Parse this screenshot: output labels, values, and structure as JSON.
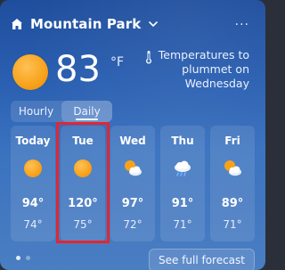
{
  "header": {
    "location": "Mountain Park",
    "more_label": "···"
  },
  "current": {
    "temperature": "83",
    "unit": "°F"
  },
  "alert": {
    "text": "Temperatures to plummet on Wednesday"
  },
  "toggle": {
    "hourly": "Hourly",
    "daily": "Daily",
    "active": "Daily"
  },
  "forecast": [
    {
      "day": "Today",
      "icon": "sun-icon",
      "hi": "94°",
      "lo": "74°"
    },
    {
      "day": "Tue",
      "icon": "sun-icon",
      "hi": "120°",
      "lo": "75°"
    },
    {
      "day": "Wed",
      "icon": "partly-cloudy-sun-icon",
      "hi": "97°",
      "lo": "72°"
    },
    {
      "day": "Thu",
      "icon": "rain-cloud-icon",
      "hi": "91°",
      "lo": "71°"
    },
    {
      "day": "Fri",
      "icon": "partly-cloudy-sun-icon",
      "hi": "89°",
      "lo": "71°"
    }
  ],
  "pager": {
    "count": 2,
    "active_index": 0
  },
  "cta": {
    "label": "See full forecast"
  },
  "colors": {
    "sun": "#f7a21b",
    "highlight": "#e3262f",
    "background_top": "#1f4e9d",
    "background_bottom": "#4a7ec2"
  }
}
